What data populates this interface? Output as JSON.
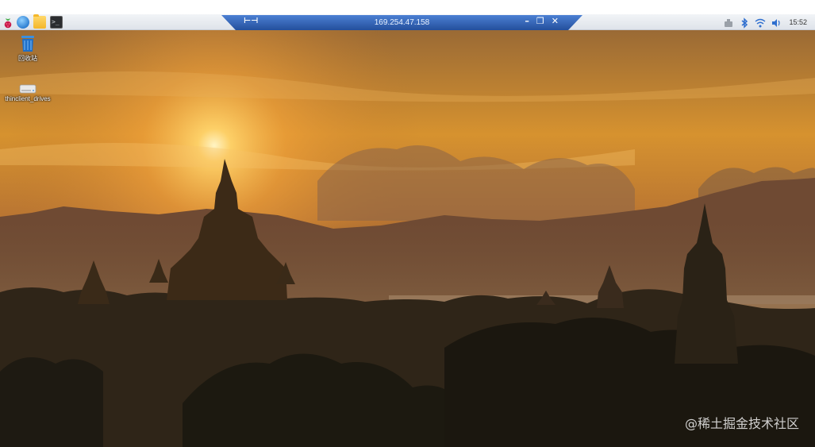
{
  "remote": {
    "host": "169.254.47.158"
  },
  "taskbar": {
    "launchers": [
      "raspberry-menu-icon",
      "web-browser-icon",
      "file-manager-icon",
      "terminal-icon"
    ],
    "terminal_glyph": ">_",
    "tray_icons": [
      "network-share-icon",
      "bluetooth-icon",
      "wifi-icon",
      "volume-icon"
    ],
    "clock": "15:52"
  },
  "desktop": {
    "icons": [
      {
        "label": "回收站",
        "icon": "trash-icon"
      },
      {
        "label": "thinclient_drives",
        "icon": "drive-icon"
      }
    ],
    "watermark": "@稀土掘金技术社区"
  },
  "colors": {
    "rdp_bar": "#2f62b5",
    "panel_top": "#f2f4f7",
    "sky_glow": "#ffd36a"
  }
}
